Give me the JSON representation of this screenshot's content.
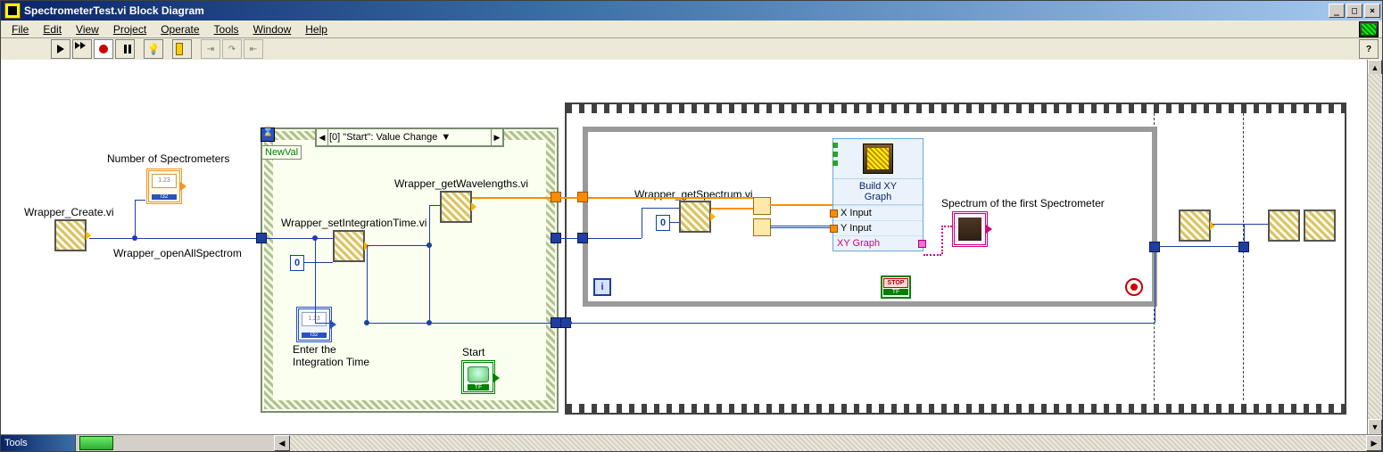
{
  "title": "SpectrometerTest.vi Block Diagram",
  "menus": [
    "File",
    "Edit",
    "View",
    "Project",
    "Operate",
    "Tools",
    "Window",
    "Help"
  ],
  "tools_palette_title": "Tools",
  "event": {
    "selector": "[0] \"Start\": Value Change",
    "newval": "NewVal"
  },
  "labels": {
    "num_spectrometers": "Number of Spectrometers",
    "wrapper_create": "Wrapper_Create.vi",
    "wrapper_openall": "Wrapper_openAllSpectrom",
    "wrapper_setint": "Wrapper_setIntegrationTime.vi",
    "wrapper_getwl": "Wrapper_getWavelengths.vi",
    "wrapper_getspec": "Wrapper_getSpectrum.vi",
    "enter_int": "Enter the\nIntegration Time",
    "start": "Start",
    "spectrum_first": "Spectrum of the first Spectrometer"
  },
  "constants": {
    "zero_a": "0",
    "zero_b": "0"
  },
  "express": {
    "title": "Build XY\nGraph",
    "xin": "X Input",
    "yin": "Y Input",
    "out": "XY Graph"
  },
  "iter": "i"
}
